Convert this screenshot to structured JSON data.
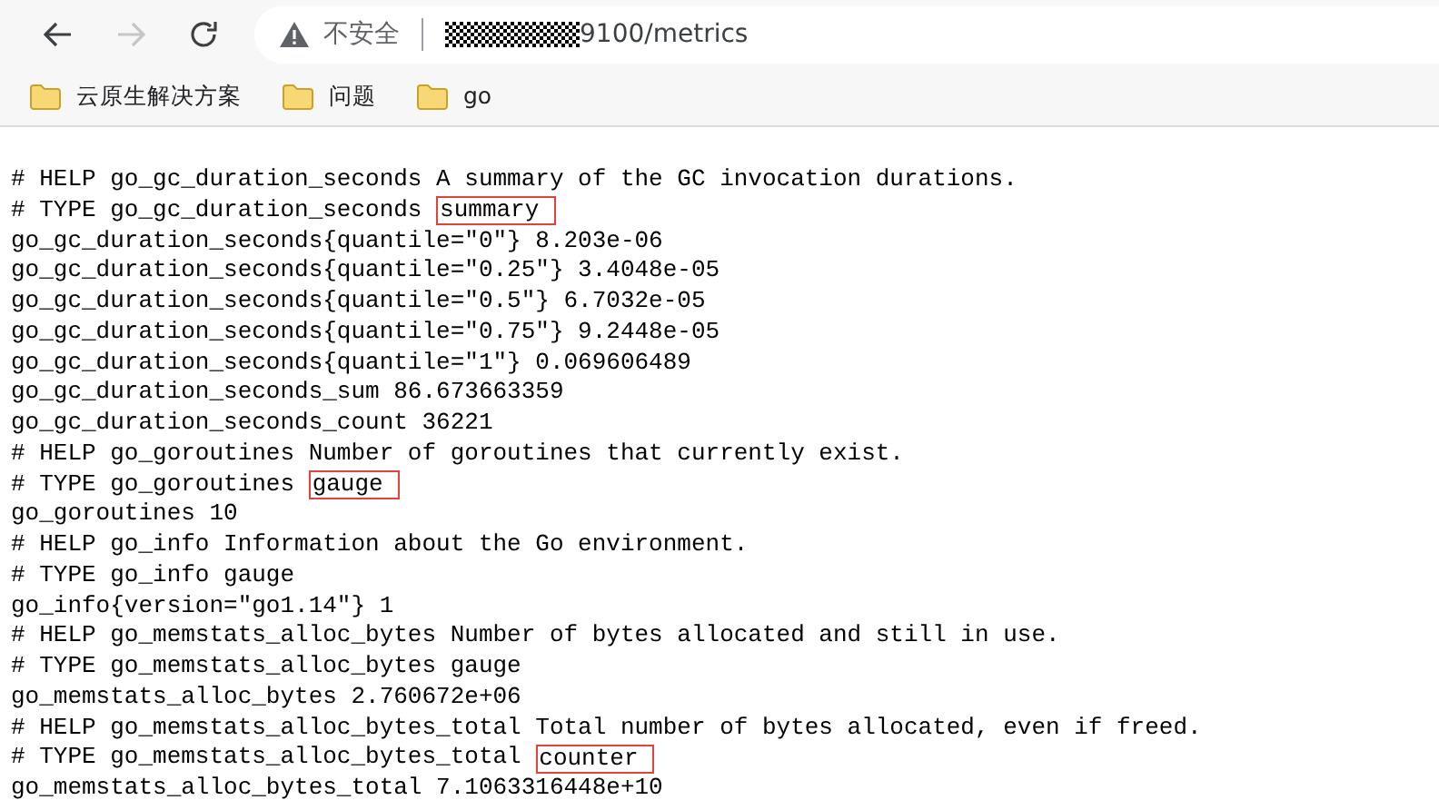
{
  "toolbar": {
    "nav_buttons": [
      {
        "kind": "back",
        "disabled": false
      },
      {
        "kind": "forward",
        "disabled": true
      },
      {
        "kind": "reload",
        "disabled": false
      }
    ],
    "address_bar": {
      "security_label": "不安全",
      "url_visible": "9100/metrics"
    }
  },
  "bookmarks": [
    {
      "label": "云原生解决方案"
    },
    {
      "label": "问题"
    },
    {
      "label": "go"
    }
  ],
  "lines": [
    {
      "text": "# HELP go_gc_duration_seconds A summary of the GC invocation durations."
    },
    {
      "text": "# TYPE go_gc_duration_seconds",
      "boxed": "summary"
    },
    {
      "text": "go_gc_duration_seconds{quantile=\"0\"} 8.203e-06"
    },
    {
      "text": "go_gc_duration_seconds{quantile=\"0.25\"} 3.4048e-05"
    },
    {
      "text": "go_gc_duration_seconds{quantile=\"0.5\"} 6.7032e-05"
    },
    {
      "text": "go_gc_duration_seconds{quantile=\"0.75\"} 9.2448e-05"
    },
    {
      "text": "go_gc_duration_seconds{quantile=\"1\"} 0.069606489"
    },
    {
      "text": "go_gc_duration_seconds_sum 86.673663359"
    },
    {
      "text": "go_gc_duration_seconds_count 36221"
    },
    {
      "text": "# HELP go_goroutines Number of goroutines that currently exist."
    },
    {
      "text": "# TYPE go_goroutines",
      "boxed": "gauge"
    },
    {
      "text": "go_goroutines 10"
    },
    {
      "text": "# HELP go_info Information about the Go environment."
    },
    {
      "text": "# TYPE go_info gauge"
    },
    {
      "text": "go_info{version=\"go1.14\"} 1"
    },
    {
      "text": "# HELP go_memstats_alloc_bytes Number of bytes allocated and still in use."
    },
    {
      "text": "# TYPE go_memstats_alloc_bytes gauge"
    },
    {
      "text": "go_memstats_alloc_bytes 2.760672e+06"
    },
    {
      "text": "# HELP go_memstats_alloc_bytes_total Total number of bytes allocated, even if freed."
    },
    {
      "text": "# TYPE go_memstats_alloc_bytes_total",
      "boxed": "counter"
    },
    {
      "text": "go_memstats_alloc_bytes_total 7.1063316448e+10"
    }
  ]
}
